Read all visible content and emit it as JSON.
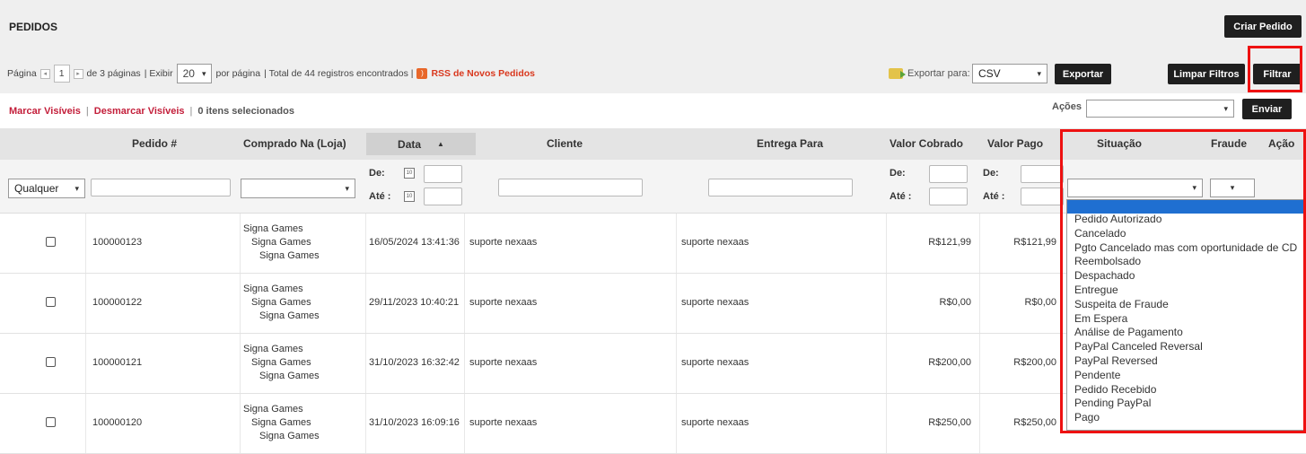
{
  "page": {
    "title": "PEDIDOS",
    "create_button": "Criar Pedido"
  },
  "pager": {
    "page_label": "Página",
    "page_value": "1",
    "of_pages": "de 3 páginas",
    "show_label": "| Exibir",
    "per_page": "20",
    "per_page_label": "por página",
    "total": "| Total de 44 registros encontrados |",
    "rss": "RSS de Novos Pedidos"
  },
  "export": {
    "label": "Exportar para:",
    "format": "CSV",
    "button": "Exportar"
  },
  "filters": {
    "clear_button": "Limpar Filtros",
    "filter_button": "Filtrar"
  },
  "mass": {
    "mark_visible": "Marcar Visíveis",
    "sep": "|",
    "unmark_visible": "Desmarcar Visíveis",
    "sep2": "|",
    "selected": "0 itens selecionados",
    "actions_label": "Ações",
    "send_button": "Enviar"
  },
  "columns": {
    "order": "Pedido #",
    "store": "Comprado Na (Loja)",
    "date": "Data",
    "customer": "Cliente",
    "ship_to": "Entrega Para",
    "charged": "Valor Cobrado",
    "paid": "Valor Pago",
    "status": "Situação",
    "fraud": "Fraude",
    "action": "Ação"
  },
  "filter_row": {
    "any": "Qualquer",
    "from": "De:",
    "to": "Até :",
    "cal": "10"
  },
  "rows": [
    {
      "order": "100000123",
      "store": [
        "Signa Games",
        "Signa Games",
        "Signa Games"
      ],
      "date": "16/05/2024 13:41:36",
      "customer": "suporte nexaas",
      "ship_to": "suporte nexaas",
      "charged": "R$121,99",
      "paid": "R$121,99"
    },
    {
      "order": "100000122",
      "store": [
        "Signa Games",
        "Signa Games",
        "Signa Games"
      ],
      "date": "29/11/2023 10:40:21",
      "customer": "suporte nexaas",
      "ship_to": "suporte nexaas",
      "charged": "R$0,00",
      "paid": "R$0,00"
    },
    {
      "order": "100000121",
      "store": [
        "Signa Games",
        "Signa Games",
        "Signa Games"
      ],
      "date": "31/10/2023 16:32:42",
      "customer": "suporte nexaas",
      "ship_to": "suporte nexaas",
      "charged": "R$200,00",
      "paid": "R$200,00"
    },
    {
      "order": "100000120",
      "store": [
        "Signa Games",
        "Signa Games",
        "Signa Games"
      ],
      "date": "31/10/2023 16:09:16",
      "customer": "suporte nexaas",
      "ship_to": "suporte nexaas",
      "charged": "R$250,00",
      "paid": "R$250,00"
    }
  ],
  "status_options": [
    "Pedido Autorizado",
    "Cancelado",
    "Pgto Cancelado mas com oportunidade de CD",
    "Reembolsado",
    "Despachado",
    "Entregue",
    "Suspeita de Fraude",
    "Em Espera",
    "Análise de Pagamento",
    "PayPal Canceled Reversal",
    "PayPal Reversed",
    "Pendente",
    "Pedido Recebido",
    "Pending PayPal",
    "Pago"
  ],
  "colors": {
    "accent_red": "#c31e3a",
    "highlight": "#ee1111",
    "dropdown_selected": "#1f6fd1",
    "dark_button": "#1f1f1f"
  }
}
